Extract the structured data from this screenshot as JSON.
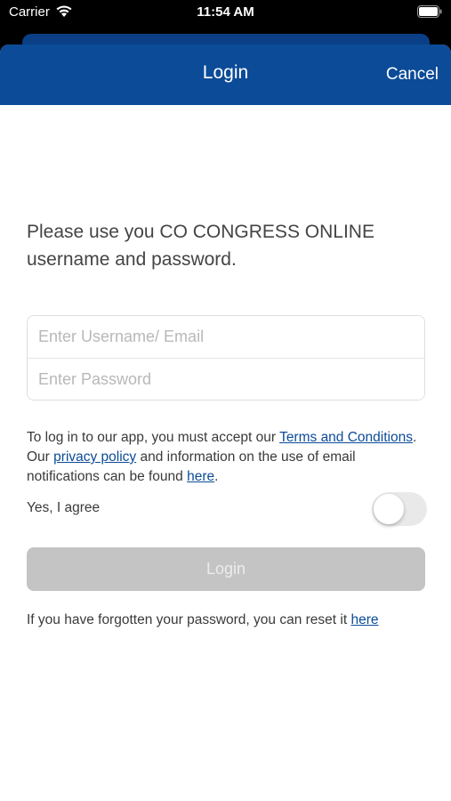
{
  "status_bar": {
    "carrier": "Carrier",
    "time": "11:54 AM"
  },
  "nav": {
    "title": "Login",
    "cancel_label": "Cancel",
    "background_color": "#0b4b98"
  },
  "intro_text": "Please use you CO CONGRESS ONLINE username and password.",
  "form": {
    "username_placeholder": "Enter Username/ Email",
    "username_value": "",
    "password_placeholder": "Enter Password",
    "password_value": ""
  },
  "terms": {
    "text_1": "To log in to our app, you must accept our ",
    "terms_link": "Terms and Conditions",
    "text_2": ". Our ",
    "privacy_link": "privacy policy",
    "text_3": " and information on the use of email notifications can be found ",
    "here_link": "here",
    "text_4": "."
  },
  "agree": {
    "label": "Yes, I agree",
    "toggled": false
  },
  "login_button_label": "Login",
  "reset": {
    "text": "If you have forgotten your password, you can reset it ",
    "link": "here"
  },
  "icons": {
    "wifi": "wifi-icon",
    "battery": "battery-icon"
  }
}
